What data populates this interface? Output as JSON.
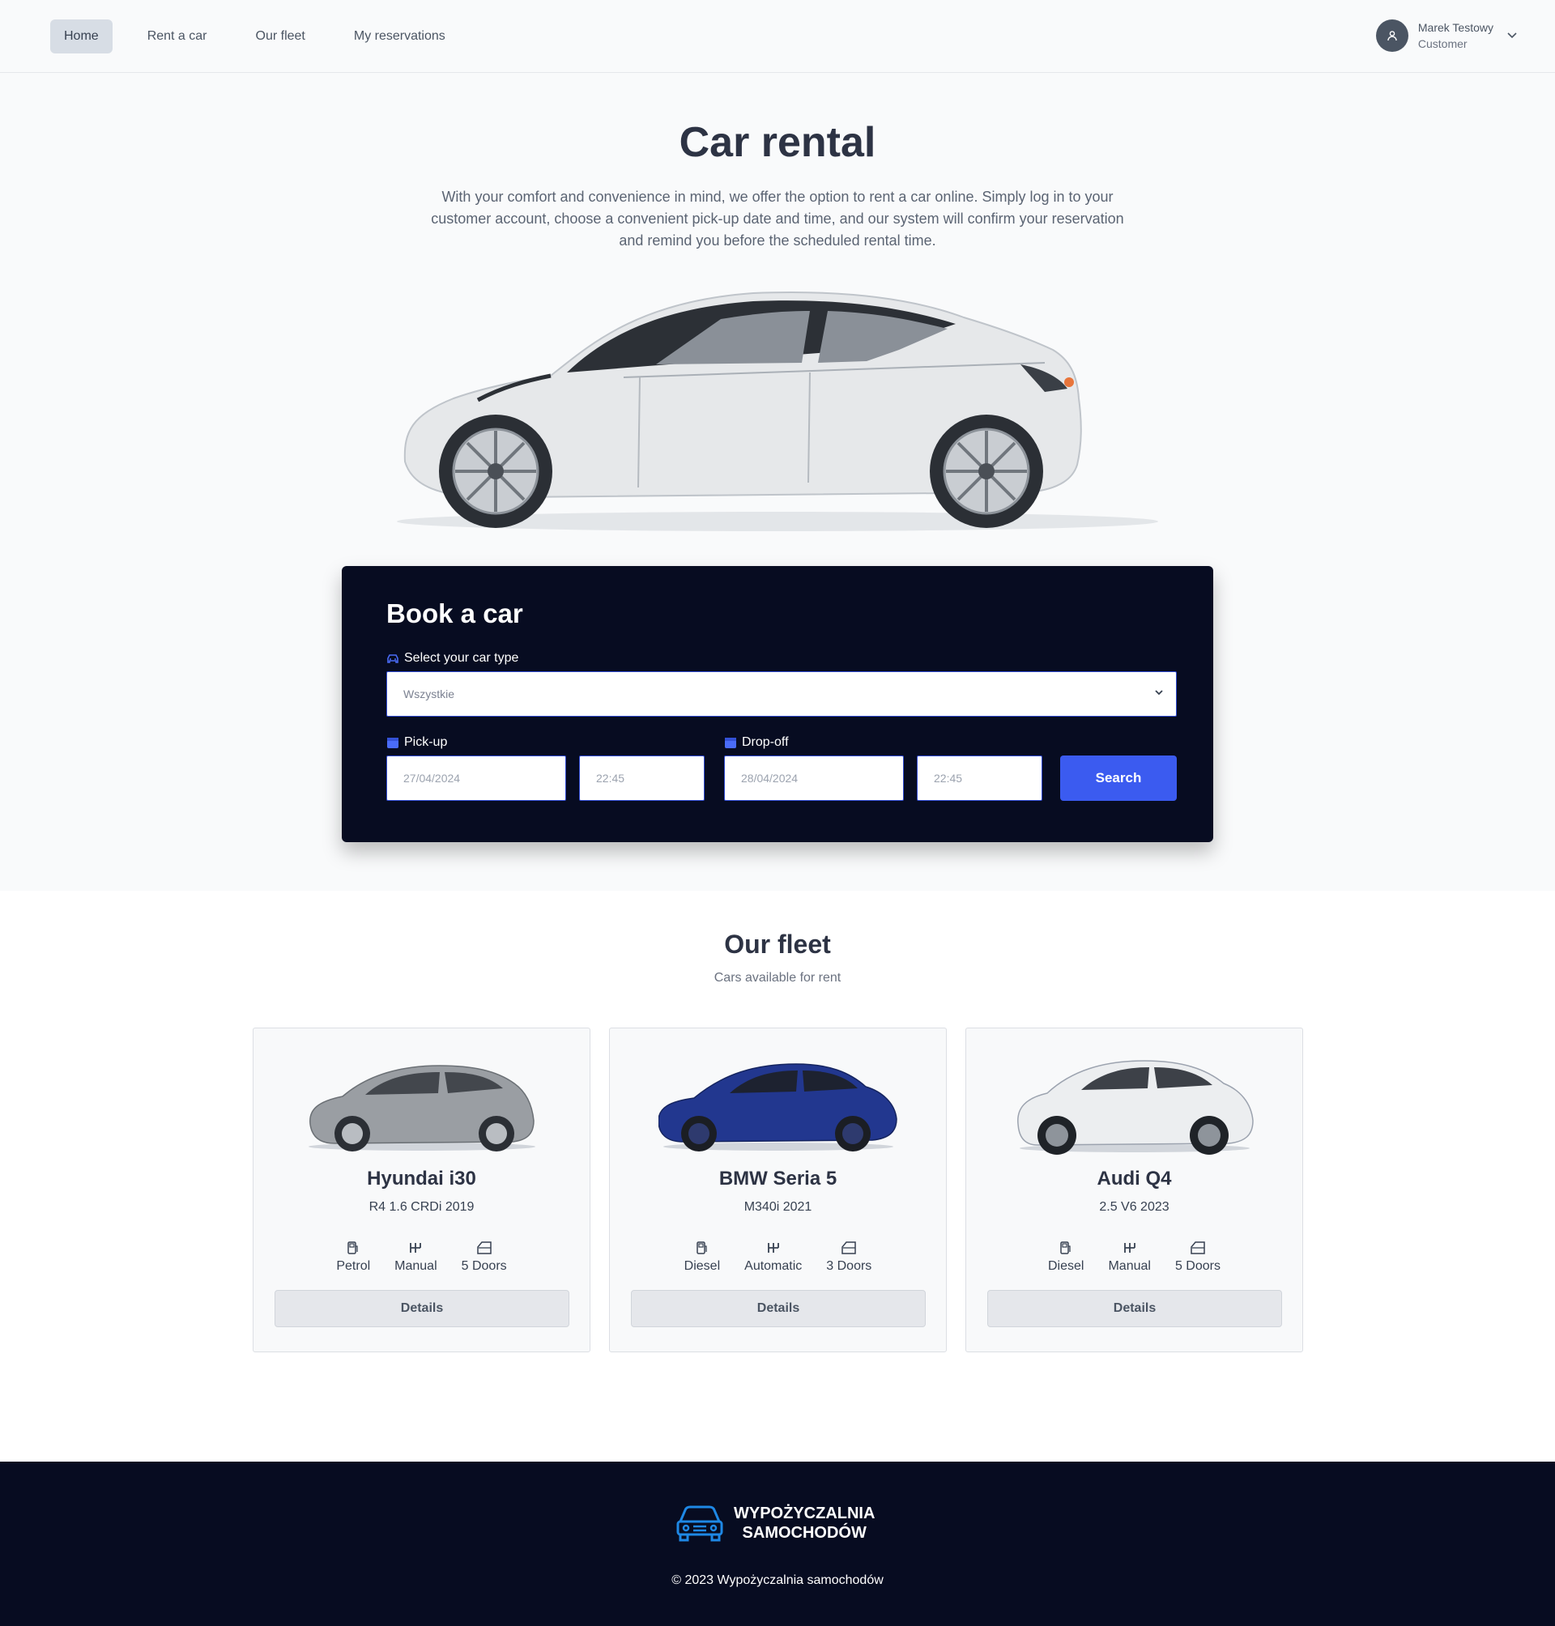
{
  "nav": {
    "links": [
      {
        "label": "Home",
        "active": true
      },
      {
        "label": "Rent a car"
      },
      {
        "label": "Our fleet"
      },
      {
        "label": "My reservations"
      }
    ],
    "user": {
      "name": "Marek Testowy",
      "role": "Customer"
    }
  },
  "hero": {
    "title": "Car rental",
    "description": "With your comfort and convenience in mind, we offer the option to rent a car online. Simply log in to your customer account, choose a convenient pick-up date and time, and our system will confirm your reservation and remind you before the scheduled rental time."
  },
  "booking": {
    "title": "Book a car",
    "car_type_label": "Select your car type",
    "car_type_value": "Wszystkie",
    "pickup_label": "Pick-up",
    "pickup_date": "27/04/2024",
    "pickup_time": "22:45",
    "dropoff_label": "Drop-off",
    "dropoff_date": "28/04/2024",
    "dropoff_time": "22:45",
    "search_label": "Search"
  },
  "fleet": {
    "title": "Our fleet",
    "subtitle": "Cars available for rent",
    "cars": [
      {
        "name": "Hyundai i30",
        "version": "R4 1.6 CRDi 2019",
        "fuel": "Petrol",
        "gearbox": "Manual",
        "doors": "5 Doors",
        "details_label": "Details",
        "color": "#9a9ea3"
      },
      {
        "name": "BMW Seria 5",
        "version": "M340i 2021",
        "fuel": "Diesel",
        "gearbox": "Automatic",
        "doors": "3 Doors",
        "details_label": "Details",
        "color": "#22378f"
      },
      {
        "name": "Audi Q4",
        "version": "2.5 V6 2023",
        "fuel": "Diesel",
        "gearbox": "Manual",
        "doors": "5 Doors",
        "details_label": "Details",
        "color": "#eceef0"
      }
    ]
  },
  "footer": {
    "logo_line1": "WYPOŻYCZALNIA",
    "logo_line2": "SAMOCHODÓW",
    "copyright": "© 2023 Wypożyczalnia samochodów"
  },
  "colors": {
    "accent": "#3b5bf0",
    "dark": "#070c21",
    "icon_accent": "#4a6cf7",
    "logo_blue": "#1e88e5"
  }
}
